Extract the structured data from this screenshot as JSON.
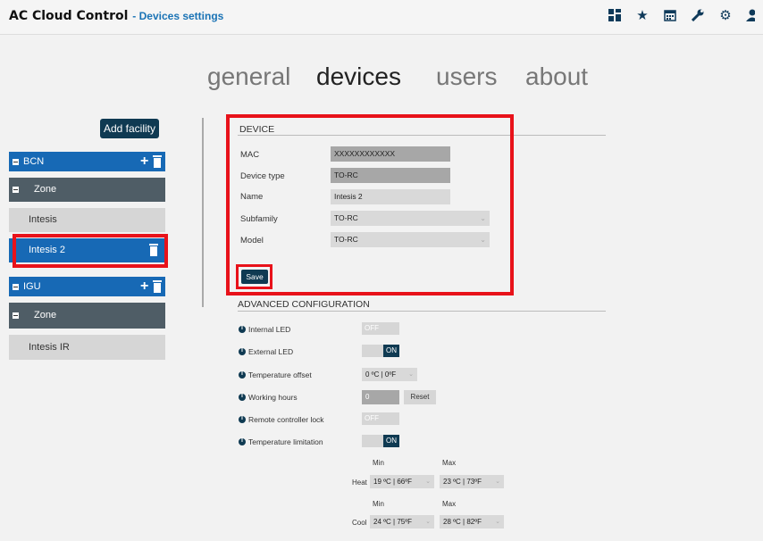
{
  "header": {
    "brand": "AC Cloud Control",
    "subtitle": "- Devices settings",
    "icons": [
      "dashboard-icon",
      "star-icon",
      "calendar-icon",
      "wrench-icon",
      "gear-icon",
      "user-icon"
    ]
  },
  "tabs": [
    {
      "label": "general",
      "active": false
    },
    {
      "label": "devices",
      "active": true
    },
    {
      "label": "users",
      "active": false
    },
    {
      "label": "about",
      "active": false
    }
  ],
  "sidebar": {
    "add_facility": "Add facility",
    "facilities": [
      {
        "name": "BCN",
        "zone": "Zone",
        "devices": [
          "Intesis",
          "Intesis 2"
        ]
      },
      {
        "name": "IGU",
        "zone": "Zone",
        "devices": [
          "Intesis IR"
        ]
      }
    ]
  },
  "device": {
    "title": "DEVICE",
    "mac_label": "MAC",
    "mac_value": "XXXXXXXXXXXX",
    "type_label": "Device type",
    "type_value": "TO-RC",
    "name_label": "Name",
    "name_value": "Intesis 2",
    "subfamily_label": "Subfamily",
    "subfamily_value": "TO-RC",
    "model_label": "Model",
    "model_value": "TO-RC",
    "save": "Save"
  },
  "advanced": {
    "title": "ADVANCED CONFIGURATION",
    "internal_led": {
      "label": "Internal LED",
      "state": "OFF"
    },
    "external_led": {
      "label": "External LED",
      "state": "ON"
    },
    "temp_offset": {
      "label": "Temperature offset",
      "value": "0 ºC | 0ºF"
    },
    "working_hours": {
      "label": "Working hours",
      "value": "0",
      "reset": "Reset"
    },
    "remote_lock": {
      "label": "Remote controller lock",
      "state": "OFF"
    },
    "temp_limit": {
      "label": "Temperature limitation",
      "state": "ON"
    },
    "min": "Min",
    "max": "Max",
    "heat": "Heat",
    "heat_min": "19 ºC | 66ºF",
    "heat_max": "23 ºC | 73ºF",
    "cool": "Cool",
    "cool_min": "24 ºC | 75ºF",
    "cool_max": "28 ºC | 82ºF"
  },
  "colors": {
    "accent": "#1769b5",
    "dark": "#0f3a52",
    "highlight": "#e8121a"
  }
}
